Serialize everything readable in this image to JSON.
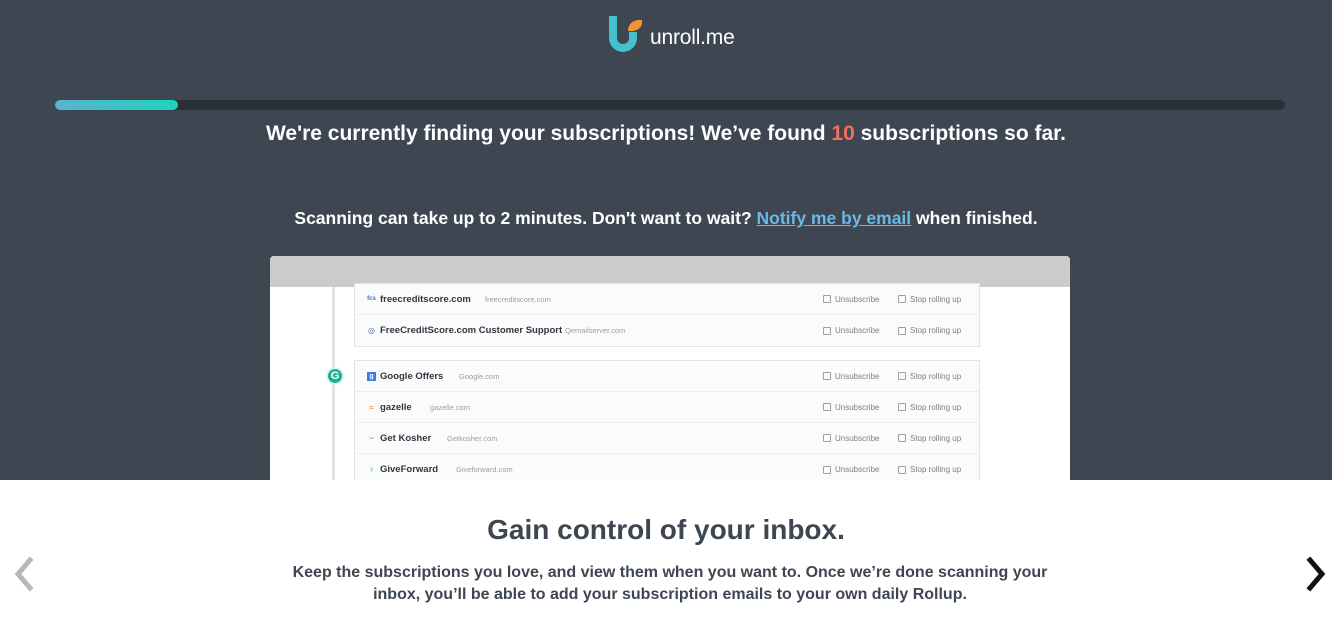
{
  "brand": {
    "name": "unroll.me",
    "logo_colors": {
      "primary": "#45c1cc",
      "accent": "#f2952f"
    }
  },
  "progress": {
    "fraction": 0.1
  },
  "status": {
    "prefix": "We're currently finding your subscriptions! We’ve found ",
    "count": "10",
    "suffix": " subscriptions so far."
  },
  "scan": {
    "prefix": "Scanning can take up to 2 minutes. Don't want to wait? ",
    "link": "Notify me by email",
    "suffix": " when finished."
  },
  "preview": {
    "group_letter": "G",
    "action_unsubscribe": "Unsubscribe",
    "action_stop": "Stop rolling up",
    "group1": [
      {
        "name": "freecreditscore.com",
        "domain": "freecreditscore.com",
        "icon": "fcs-icon"
      },
      {
        "name": "FreeCreditScore.com Customer Support",
        "domain": "Qemailserver.com",
        "icon": "support-icon"
      }
    ],
    "group2": [
      {
        "name": "Google Offers",
        "domain": "Google.com",
        "icon": "google-icon"
      },
      {
        "name": "gazelle",
        "domain": "gazelle.com",
        "icon": "gazelle-icon"
      },
      {
        "name": "Get Kosher",
        "domain": "Getkosher.com",
        "icon": "kosher-icon"
      },
      {
        "name": "GiveForward",
        "domain": "Giveforward.com",
        "icon": "giveforward-icon"
      }
    ]
  },
  "promo": {
    "title": "Gain control of your inbox.",
    "body": "Keep the subscriptions you love, and view them when you want to. Once we’re done scanning your inbox, you’ll be able to add your subscription emails to your own daily Rollup."
  },
  "nav": {
    "prev_icon": "chevron-left-icon",
    "next_icon": "chevron-right-icon"
  }
}
